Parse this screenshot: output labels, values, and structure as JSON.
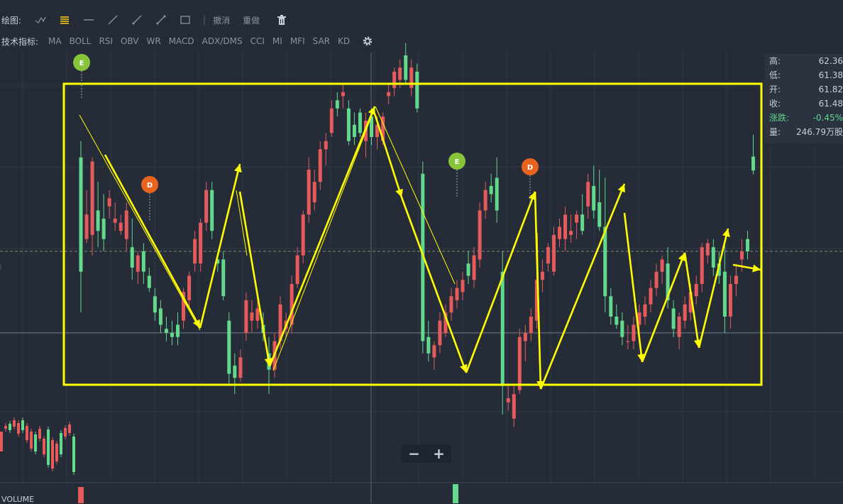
{
  "toolbar": {
    "draw_label": "绘图:",
    "undo": "撤消",
    "redo": "重做",
    "indicator_label": "技术指标:",
    "indicators": [
      "MA",
      "BOLL",
      "RSI",
      "OBV",
      "WR",
      "MACD",
      "ADX/DMS",
      "CCI",
      "MI",
      "MFI",
      "SAR",
      "KD"
    ]
  },
  "info": {
    "high_label": "高:",
    "high": "62.36",
    "low_label": "低:",
    "low": "61.38",
    "open_label": "开:",
    "open": "61.82",
    "close_label": "收:",
    "close": "61.48",
    "change_label": "涨跌:",
    "change": "-0.45%",
    "volume_label": "量:",
    "volume": "246.79万股"
  },
  "zoom": {
    "minus": "−",
    "plus": "+"
  },
  "volume_label": "VOLUME",
  "colors": {
    "up": "#e55b5b",
    "down": "#62d98b",
    "annotation": "#ffff00",
    "bg": "#252c38",
    "event_e": "#88c43a",
    "event_d": "#e8641e"
  },
  "chart_data": {
    "type": "candlestick",
    "candles": [
      {
        "o": 61.8,
        "h": 62.2,
        "l": 58.0,
        "c": 59.0
      },
      {
        "o": 59.8,
        "h": 61.0,
        "l": 59.7,
        "c": 60.4
      },
      {
        "o": 59.9,
        "h": 61.8,
        "l": 59.4,
        "c": 61.7
      },
      {
        "o": 60.5,
        "h": 61.2,
        "l": 59.6,
        "c": 60.0
      },
      {
        "o": 60.3,
        "h": 60.9,
        "l": 59.5,
        "c": 59.8
      },
      {
        "o": 60.6,
        "h": 61.0,
        "l": 60.3,
        "c": 60.8
      },
      {
        "o": 60.2,
        "h": 60.7,
        "l": 60.0,
        "c": 60.3
      },
      {
        "o": 60.0,
        "h": 60.4,
        "l": 59.9,
        "c": 60.2
      },
      {
        "o": 59.8,
        "h": 60.7,
        "l": 59.5,
        "c": 60.5
      },
      {
        "o": 59.6,
        "h": 60.3,
        "l": 58.8,
        "c": 59.1
      },
      {
        "o": 59.0,
        "h": 59.5,
        "l": 58.7,
        "c": 59.4
      },
      {
        "o": 59.5,
        "h": 59.7,
        "l": 58.7,
        "c": 59.0
      },
      {
        "o": 58.9,
        "h": 59.1,
        "l": 58.5,
        "c": 58.6
      },
      {
        "o": 58.4,
        "h": 58.6,
        "l": 57.8,
        "c": 58.0
      },
      {
        "o": 58.1,
        "h": 58.3,
        "l": 57.5,
        "c": 57.7
      },
      {
        "o": 57.6,
        "h": 57.9,
        "l": 57.3,
        "c": 57.5
      },
      {
        "o": 57.5,
        "h": 57.8,
        "l": 57.2,
        "c": 57.4
      },
      {
        "o": 57.7,
        "h": 58.0,
        "l": 57.2,
        "c": 57.4
      },
      {
        "o": 57.8,
        "h": 58.6,
        "l": 57.6,
        "c": 58.5
      },
      {
        "o": 58.3,
        "h": 59.0,
        "l": 58.1,
        "c": 58.9
      },
      {
        "o": 59.2,
        "h": 60.0,
        "l": 59.0,
        "c": 59.8
      },
      {
        "o": 59.2,
        "h": 60.3,
        "l": 59.0,
        "c": 60.2
      },
      {
        "o": 60.2,
        "h": 61.2,
        "l": 60.0,
        "c": 61.0
      },
      {
        "o": 61.0,
        "h": 61.2,
        "l": 59.8,
        "c": 60.0
      },
      {
        "o": 59.3,
        "h": 59.4,
        "l": 59.0,
        "c": 59.2
      },
      {
        "o": 59.3,
        "h": 59.5,
        "l": 58.3,
        "c": 58.4
      },
      {
        "o": 57.8,
        "h": 58.0,
        "l": 56.2,
        "c": 56.5
      },
      {
        "o": 56.7,
        "h": 57.0,
        "l": 56.0,
        "c": 56.4
      },
      {
        "o": 56.4,
        "h": 57.1,
        "l": 56.3,
        "c": 56.9
      },
      {
        "o": 57.5,
        "h": 58.5,
        "l": 57.3,
        "c": 58.3
      },
      {
        "o": 57.8,
        "h": 58.3,
        "l": 57.5,
        "c": 58.0
      },
      {
        "o": 57.8,
        "h": 58.4,
        "l": 57.6,
        "c": 58.1
      },
      {
        "o": 57.7,
        "h": 58.0,
        "l": 57.3,
        "c": 57.5
      },
      {
        "o": 57.0,
        "h": 57.4,
        "l": 56.0,
        "c": 56.6
      },
      {
        "o": 56.6,
        "h": 57.5,
        "l": 56.4,
        "c": 57.3
      },
      {
        "o": 57.3,
        "h": 58.4,
        "l": 57.1,
        "c": 58.2
      },
      {
        "o": 57.6,
        "h": 58.0,
        "l": 57.4,
        "c": 57.8
      },
      {
        "o": 57.7,
        "h": 58.9,
        "l": 57.5,
        "c": 58.7
      },
      {
        "o": 58.7,
        "h": 59.6,
        "l": 58.6,
        "c": 59.4
      },
      {
        "o": 59.4,
        "h": 60.5,
        "l": 59.2,
        "c": 60.4
      },
      {
        "o": 60.4,
        "h": 61.8,
        "l": 60.2,
        "c": 61.5
      },
      {
        "o": 60.7,
        "h": 61.5,
        "l": 60.5,
        "c": 61.2
      },
      {
        "o": 61.2,
        "h": 62.2,
        "l": 61.0,
        "c": 62.0
      },
      {
        "o": 62.0,
        "h": 62.4,
        "l": 61.6,
        "c": 62.2
      },
      {
        "o": 62.4,
        "h": 63.2,
        "l": 62.3,
        "c": 63.0
      },
      {
        "o": 63.2,
        "h": 63.4,
        "l": 62.8,
        "c": 63.0
      },
      {
        "o": 63.3,
        "h": 63.6,
        "l": 63.0,
        "c": 63.4
      },
      {
        "o": 63.0,
        "h": 63.2,
        "l": 62.1,
        "c": 62.2
      },
      {
        "o": 62.6,
        "h": 62.9,
        "l": 62.1,
        "c": 62.3
      },
      {
        "o": 62.9,
        "h": 63.0,
        "l": 62.3,
        "c": 62.4
      },
      {
        "o": 62.2,
        "h": 62.9,
        "l": 61.8,
        "c": 62.7
      },
      {
        "o": 62.8,
        "h": 63.0,
        "l": 62.1,
        "c": 62.3
      },
      {
        "o": 62.3,
        "h": 62.8,
        "l": 62.0,
        "c": 62.6
      },
      {
        "o": 62.2,
        "h": 62.9,
        "l": 62.1,
        "c": 62.8
      },
      {
        "o": 63.3,
        "h": 63.6,
        "l": 63.1,
        "c": 63.4
      },
      {
        "o": 63.5,
        "h": 64.0,
        "l": 63.3,
        "c": 63.9
      },
      {
        "o": 63.7,
        "h": 64.2,
        "l": 63.5,
        "c": 64.0
      },
      {
        "o": 64.3,
        "h": 64.6,
        "l": 63.6,
        "c": 63.7
      },
      {
        "o": 63.5,
        "h": 64.2,
        "l": 63.3,
        "c": 64.0
      },
      {
        "o": 63.9,
        "h": 64.1,
        "l": 62.9,
        "c": 63.0
      },
      {
        "o": 61.4,
        "h": 61.7,
        "l": 57.0,
        "c": 57.3
      },
      {
        "o": 57.4,
        "h": 57.8,
        "l": 56.8,
        "c": 57.0
      },
      {
        "o": 56.9,
        "h": 57.3,
        "l": 56.6,
        "c": 57.2
      },
      {
        "o": 57.2,
        "h": 58.0,
        "l": 57.0,
        "c": 57.8
      },
      {
        "o": 57.5,
        "h": 58.2,
        "l": 57.4,
        "c": 58.0
      },
      {
        "o": 58.0,
        "h": 58.6,
        "l": 57.8,
        "c": 58.4
      },
      {
        "o": 58.3,
        "h": 58.8,
        "l": 58.1,
        "c": 58.6
      },
      {
        "o": 58.5,
        "h": 59.0,
        "l": 58.3,
        "c": 58.8
      },
      {
        "o": 59.2,
        "h": 59.5,
        "l": 58.7,
        "c": 58.9
      },
      {
        "o": 58.8,
        "h": 59.6,
        "l": 58.6,
        "c": 59.4
      },
      {
        "o": 59.3,
        "h": 60.7,
        "l": 59.1,
        "c": 60.5
      },
      {
        "o": 60.5,
        "h": 61.2,
        "l": 60.3,
        "c": 61.0
      },
      {
        "o": 61.1,
        "h": 61.4,
        "l": 60.7,
        "c": 60.9
      },
      {
        "o": 61.3,
        "h": 61.8,
        "l": 60.2,
        "c": 60.5
      },
      {
        "o": 59.0,
        "h": 59.5,
        "l": 55.5,
        "c": 56.2
      },
      {
        "o": 55.8,
        "h": 56.2,
        "l": 55.6,
        "c": 55.9
      },
      {
        "o": 55.4,
        "h": 56.2,
        "l": 55.2,
        "c": 56.0
      },
      {
        "o": 56.1,
        "h": 57.6,
        "l": 56.0,
        "c": 57.4
      },
      {
        "o": 57.3,
        "h": 57.7,
        "l": 56.8,
        "c": 57.5
      },
      {
        "o": 57.5,
        "h": 58.1,
        "l": 57.3,
        "c": 57.9
      },
      {
        "o": 57.8,
        "h": 59.0,
        "l": 57.6,
        "c": 58.8
      },
      {
        "o": 58.8,
        "h": 59.3,
        "l": 58.5,
        "c": 59.0
      },
      {
        "o": 59.2,
        "h": 59.7,
        "l": 59.0,
        "c": 59.6
      },
      {
        "o": 59.0,
        "h": 60.1,
        "l": 58.9,
        "c": 59.9
      },
      {
        "o": 59.8,
        "h": 60.3,
        "l": 59.6,
        "c": 60.1
      },
      {
        "o": 59.8,
        "h": 60.6,
        "l": 59.5,
        "c": 60.4
      },
      {
        "o": 59.9,
        "h": 60.4,
        "l": 59.7,
        "c": 60.0
      },
      {
        "o": 60.2,
        "h": 60.5,
        "l": 59.8,
        "c": 60.4
      },
      {
        "o": 60.4,
        "h": 60.9,
        "l": 59.9,
        "c": 60.0
      },
      {
        "o": 60.6,
        "h": 61.4,
        "l": 60.3,
        "c": 61.2
      },
      {
        "o": 61.1,
        "h": 61.6,
        "l": 60.3,
        "c": 60.5
      },
      {
        "o": 60.7,
        "h": 61.5,
        "l": 60.0,
        "c": 60.1
      },
      {
        "o": 60.1,
        "h": 61.3,
        "l": 58.0,
        "c": 58.4
      },
      {
        "o": 58.4,
        "h": 58.6,
        "l": 57.7,
        "c": 57.9
      },
      {
        "o": 57.9,
        "h": 58.2,
        "l": 57.6,
        "c": 57.7
      },
      {
        "o": 57.8,
        "h": 58.0,
        "l": 57.2,
        "c": 57.4
      },
      {
        "o": 57.3,
        "h": 57.7,
        "l": 57.1,
        "c": 57.3
      },
      {
        "o": 57.3,
        "h": 57.9,
        "l": 57.1,
        "c": 57.7
      },
      {
        "o": 57.7,
        "h": 58.2,
        "l": 57.5,
        "c": 58.0
      },
      {
        "o": 57.9,
        "h": 58.4,
        "l": 57.7,
        "c": 58.2
      },
      {
        "o": 58.2,
        "h": 58.8,
        "l": 58.0,
        "c": 58.6
      },
      {
        "o": 58.6,
        "h": 59.2,
        "l": 58.4,
        "c": 59.0
      },
      {
        "o": 59.0,
        "h": 59.4,
        "l": 58.7,
        "c": 59.3
      },
      {
        "o": 59.2,
        "h": 59.6,
        "l": 58.1,
        "c": 58.3
      },
      {
        "o": 58.1,
        "h": 58.3,
        "l": 57.4,
        "c": 57.6
      },
      {
        "o": 57.4,
        "h": 58.0,
        "l": 57.1,
        "c": 57.9
      },
      {
        "o": 57.8,
        "h": 58.4,
        "l": 57.6,
        "c": 58.2
      },
      {
        "o": 58.0,
        "h": 58.7,
        "l": 57.8,
        "c": 58.5
      },
      {
        "o": 58.4,
        "h": 58.9,
        "l": 58.2,
        "c": 58.7
      },
      {
        "o": 58.7,
        "h": 59.7,
        "l": 58.5,
        "c": 59.6
      },
      {
        "o": 59.4,
        "h": 59.8,
        "l": 59.2,
        "c": 59.7
      },
      {
        "o": 59.6,
        "h": 59.8,
        "l": 58.9,
        "c": 59.1
      },
      {
        "o": 59.2,
        "h": 59.5,
        "l": 58.7,
        "c": 58.9
      },
      {
        "o": 59.0,
        "h": 59.7,
        "l": 57.5,
        "c": 57.9
      },
      {
        "o": 57.9,
        "h": 58.9,
        "l": 57.6,
        "c": 58.7
      },
      {
        "o": 58.7,
        "h": 59.2,
        "l": 58.4,
        "c": 58.9
      },
      {
        "o": 59.3,
        "h": 59.8,
        "l": 59.0,
        "c": 59.5
      },
      {
        "o": 59.8,
        "h": 60.0,
        "l": 59.3,
        "c": 59.5
      },
      {
        "o": 61.82,
        "h": 62.36,
        "l": 61.38,
        "c": 61.48
      }
    ],
    "event_markers": [
      {
        "label": "E",
        "candle": 0
      },
      {
        "label": "D",
        "candle": 12
      },
      {
        "label": "E",
        "candle": 60
      },
      {
        "label": "D",
        "candle": 74
      }
    ],
    "volume": {
      "label": "VOLUME"
    }
  }
}
